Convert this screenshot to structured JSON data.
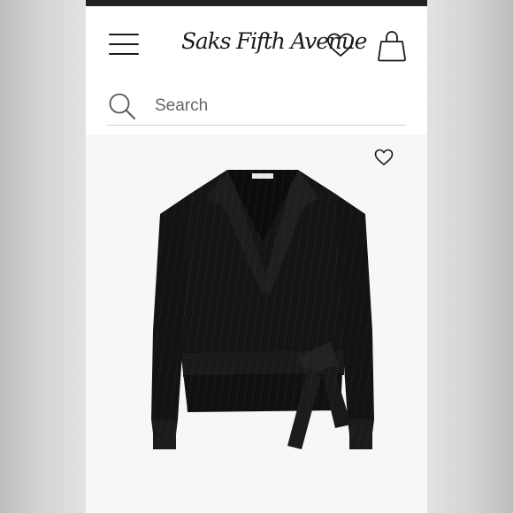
{
  "brand": {
    "logo_text": "Saks Fifth Avenue"
  },
  "header": {
    "menu_icon": "hamburger-menu-icon",
    "wishlist_icon": "heart-icon",
    "bag_icon": "shopping-bag-icon"
  },
  "search": {
    "placeholder": "Search",
    "icon": "search-icon"
  },
  "product": {
    "image_subject": "black pinstripe wrap blouse with tie waist",
    "wishlist_icon": "heart-outline-icon"
  },
  "colors": {
    "page_background": "#ffffff",
    "product_background": "#f7f7f7",
    "text_primary": "#1a1a1a",
    "garment": "#131313"
  }
}
